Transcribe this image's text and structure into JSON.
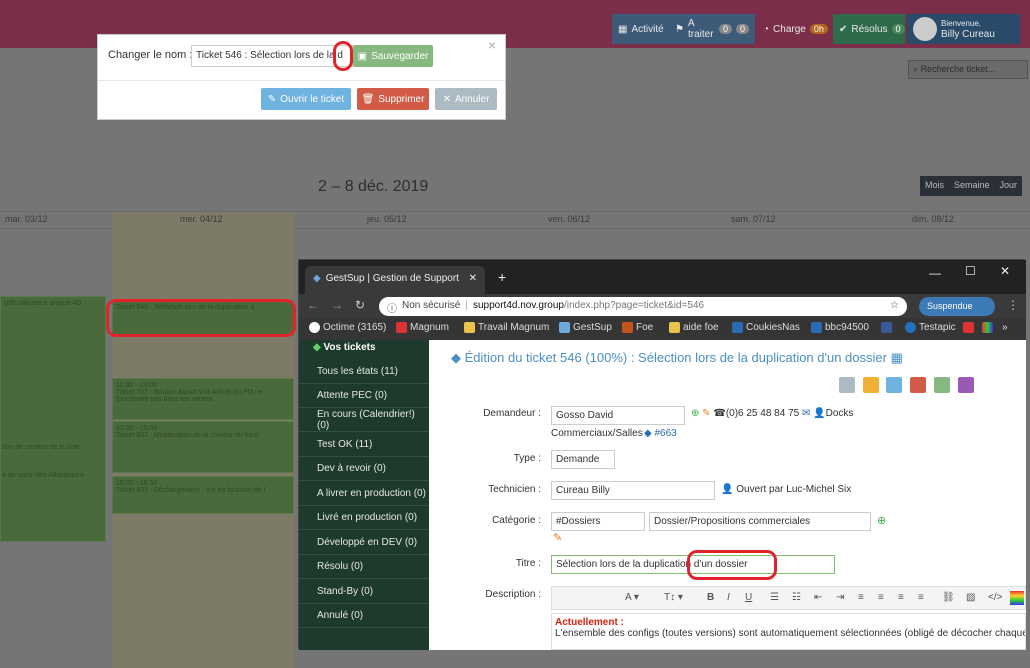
{
  "topbar": {
    "items": [
      {
        "label": "Activité"
      },
      {
        "label": "A traiter",
        "count1": "0",
        "count2": "0"
      },
      {
        "label": "Charge",
        "count": "0h"
      },
      {
        "label": "Résolus",
        "count": "0"
      }
    ],
    "user": {
      "greeting": "Bienvenue,",
      "name": "Billy Cureau"
    },
    "search_placeholder": "Recherche ticket..."
  },
  "calendar": {
    "title": "2 – 8 déc. 2019",
    "views": [
      "Mois",
      "Semaine",
      "Jour"
    ],
    "days": [
      "mar. 03/12",
      "mer. 04/12",
      "jeu. 05/12",
      "ven. 06/12",
      "sam. 07/12",
      "dim. 08/12"
    ],
    "events": [
      {
        "text": "039:utilisateur unique 4D"
      },
      {
        "text": "Ticket 546 : Sélection lors de la duplication d"
      },
      {
        "time": "11:30 - 13:00",
        "text": "Ticket 707 : Bouton &quot;Voir Article ou PO ne fonctionne pas dans les ventes"
      },
      {
        "time": "13:00 - 15:00",
        "text": "Ticket 552 : Modification de la couleur du fond"
      },
      {
        "time": "15:00 - 18:30",
        "text": "Ticket 601 : Déchargement - trie en fonction de l"
      },
      {
        "text": "tion de couleur de la liste"
      },
      {
        "text": "é de sortir des Affectations"
      }
    ]
  },
  "dialog": {
    "label": "Changer le nom :",
    "input_value": "Ticket 546 : Sélection lors de la d",
    "save": "Sauvegarder",
    "open": "Ouvrir le ticket",
    "delete": "Supprimer",
    "cancel": "Annuler",
    "close": "×"
  },
  "browser": {
    "tab_title": "GestSup | Gestion de Support",
    "new_tab": "+",
    "security": "Non sécurisé",
    "url_host": "support4d.nov.group",
    "url_path": "/index.php?page=ticket&id=546",
    "profile": "Suspendue",
    "bookmarks": [
      "Octime (3165)",
      "Magnum",
      "Travail Magnum",
      "GestSup",
      "Foe",
      "aide foe",
      "CoukiesNas",
      "bbc94500",
      "Testapic"
    ]
  },
  "sidebar": {
    "header": "Vos tickets",
    "items": [
      "Tous les états (11)",
      "Attente PEC (0)",
      "En cours (Calendrier!) (0)",
      "Test OK (11)",
      "Dev à revoir (0)",
      "A livrer en production (0)",
      "Livré en production (0)",
      "Développé en DEV (0)",
      "Résolu (0)",
      "Stand-By (0)",
      "Annulé (0)"
    ]
  },
  "ticket": {
    "heading": "Édition du ticket 546 (100%) : Sélection lors de la duplication d'un dossier",
    "labels": {
      "demandeur": "Demandeur :",
      "type": "Type :",
      "technicien": "Technicien :",
      "categorie": "Catégorie :",
      "titre": "Titre :",
      "description": "Description :"
    },
    "demandeur": "Gosso David",
    "phone": "(0)6 25 48 84 75",
    "docks": "Docks",
    "service": "Commerciaux/Salles",
    "ref": "#663",
    "type": "Demande",
    "technicien": "Cureau Billy",
    "ouvert_par": "Ouvert par Luc-Michel Six",
    "categorie": "#Dossiers",
    "sous_categorie": "Dossier/Propositions commerciales",
    "titre": "Sélection lors de la duplication d'un dossier",
    "desc_heading": "Actuellement :",
    "desc_text": "L'ensemble des configs (toutes versions) sont automatiquement sélectionnées (obligé de décocher chaque lign"
  }
}
